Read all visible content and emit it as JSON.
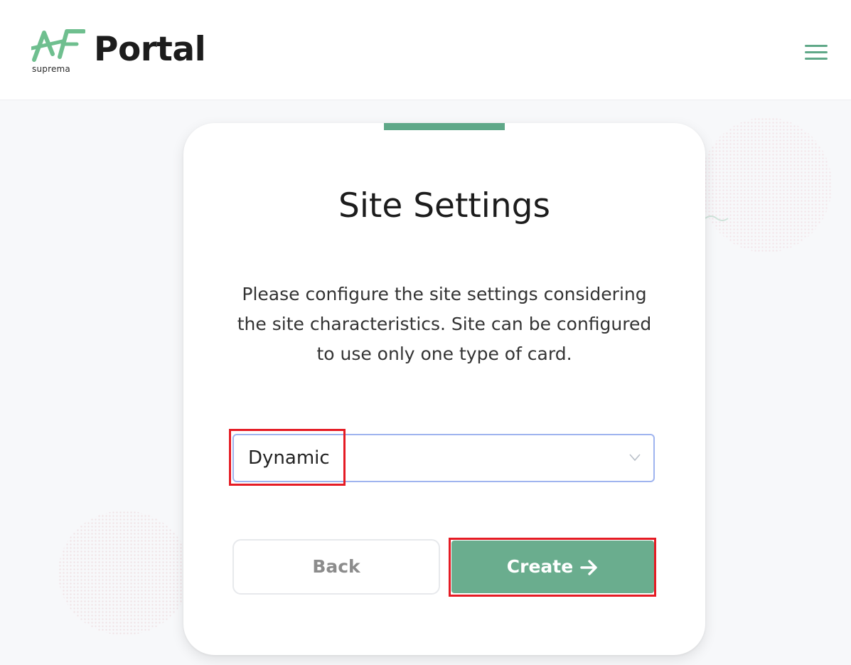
{
  "header": {
    "brand_sub": "suprema",
    "brand_name": "Portal"
  },
  "card": {
    "title": "Site Settings",
    "description": "Please configure the site settings considering the site characteristics. Site can be configured to use only one type of card.",
    "select": {
      "value": "Dynamic"
    },
    "buttons": {
      "back": "Back",
      "create": "Create"
    }
  },
  "colors": {
    "accent": "#5fa888",
    "primary_button": "#6aad8e",
    "highlight_box": "#e51b24",
    "select_border": "#9fb4ef"
  },
  "icons": {
    "menu": "hamburger-menu-icon",
    "select": "chevron-down-icon",
    "create": "arrow-right-icon"
  }
}
